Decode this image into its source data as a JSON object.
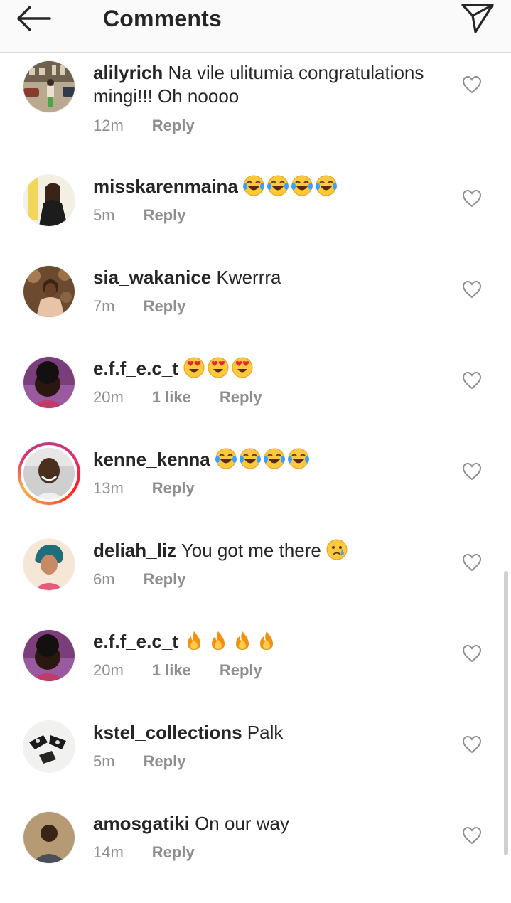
{
  "header": {
    "title": "Comments",
    "back_icon": "arrow-left-icon",
    "share_icon": "paper-plane-icon"
  },
  "comments": [
    {
      "username": "alilyrich",
      "text": "Na vile ulitumia congratulations mingi!!! Oh noooo",
      "emoji": "",
      "emoji_count": 0,
      "time": "12m",
      "likes": "",
      "reply": "Reply"
    },
    {
      "username": "misskarenmaina",
      "text": "",
      "emoji": "face-with-tears-of-joy",
      "emoji_count": 4,
      "time": "5m",
      "likes": "",
      "reply": "Reply"
    },
    {
      "username": "sia_wakanice",
      "text": "Kwerrra",
      "emoji": "",
      "emoji_count": 0,
      "time": "7m",
      "likes": "",
      "reply": "Reply"
    },
    {
      "username": "e.f.f_e.c_t",
      "text": "",
      "emoji": "heart-eyes",
      "emoji_count": 3,
      "time": "20m",
      "likes": "1 like",
      "reply": "Reply"
    },
    {
      "username": "kenne_kenna",
      "text": "",
      "emoji": "face-with-tears-of-joy",
      "emoji_count": 4,
      "time": "13m",
      "likes": "",
      "reply": "Reply"
    },
    {
      "username": "deliah_liz",
      "text": "You got me there",
      "emoji": "crying-face",
      "emoji_count": 1,
      "time": "6m",
      "likes": "",
      "reply": "Reply"
    },
    {
      "username": "e.f.f_e.c_t",
      "text": "",
      "emoji": "fire",
      "emoji_count": 4,
      "time": "20m",
      "likes": "1 like",
      "reply": "Reply"
    },
    {
      "username": "kstel_collections",
      "text": "Palk",
      "emoji": "",
      "emoji_count": 0,
      "time": "5m",
      "likes": "",
      "reply": "Reply"
    },
    {
      "username": "amosgatiki",
      "text": "On our way",
      "emoji": "",
      "emoji_count": 0,
      "time": "14m",
      "likes": "",
      "reply": "Reply"
    }
  ],
  "colors": {
    "text": "#262626",
    "meta": "#8e8e8e",
    "header_bg": "#fafafa",
    "story_ring": "#e1306c"
  }
}
